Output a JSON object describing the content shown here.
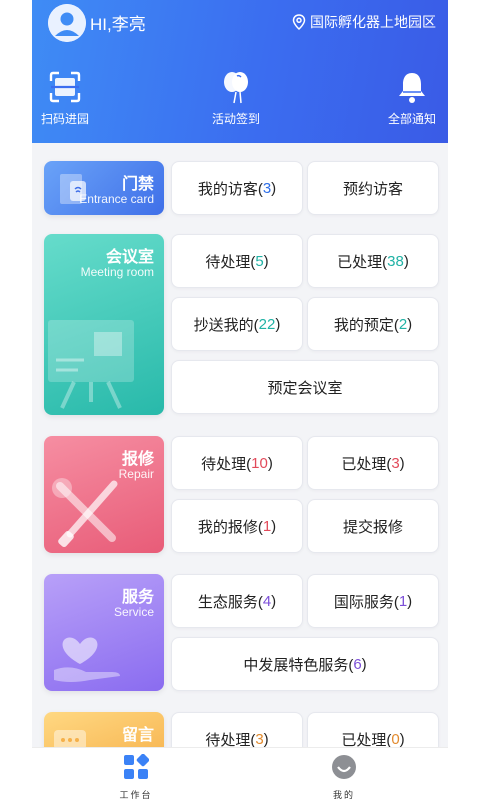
{
  "header": {
    "greeting": "HI,李亮",
    "location": "国际孵化器上地园区",
    "quick_actions": [
      {
        "label": "扫码进园",
        "icon": "scan-icon"
      },
      {
        "label": "活动签到",
        "icon": "balloon-icon"
      },
      {
        "label": "全部通知",
        "icon": "bell-icon"
      }
    ]
  },
  "sections": {
    "access": {
      "title": "门禁",
      "subtitle": "Entrance card",
      "buttons": [
        {
          "label": "我的访客(",
          "count": "3",
          "suffix": ")"
        },
        {
          "label": "预约访客"
        }
      ]
    },
    "meeting": {
      "title": "会议室",
      "subtitle": "Meeting room",
      "buttons": [
        {
          "label": "待处理(",
          "count": "5",
          "suffix": ")"
        },
        {
          "label": "已处理(",
          "count": "38",
          "suffix": ")"
        },
        {
          "label": "抄送我的(",
          "count": "22",
          "suffix": ")"
        },
        {
          "label": "我的预定(",
          "count": "2",
          "suffix": ")"
        },
        {
          "label": "预定会议室"
        }
      ]
    },
    "repair": {
      "title": "报修",
      "subtitle": "Repair",
      "buttons": [
        {
          "label": "待处理(",
          "count": "10",
          "suffix": ")"
        },
        {
          "label": "已处理(",
          "count": "3",
          "suffix": ")"
        },
        {
          "label": "我的报修(",
          "count": "1",
          "suffix": ")"
        },
        {
          "label": "提交报修"
        }
      ]
    },
    "service": {
      "title": "服务",
      "subtitle": "Service",
      "buttons": [
        {
          "label": "生态服务(",
          "count": "4",
          "suffix": ")"
        },
        {
          "label": "国际服务(",
          "count": "1",
          "suffix": ")"
        },
        {
          "label": "中发展特色服务(",
          "count": "6",
          "suffix": ")"
        }
      ]
    },
    "message": {
      "title": "留言",
      "buttons": [
        {
          "label": "待处理(",
          "count": "3",
          "suffix": ")"
        },
        {
          "label": "已处理(",
          "count": "0",
          "suffix": ")"
        }
      ]
    }
  },
  "bottom_nav": [
    {
      "label": "工作台",
      "icon": "grid-icon",
      "active": true
    },
    {
      "label": "我的",
      "icon": "profile-icon",
      "active": false
    }
  ],
  "colors": {
    "header_gradient": [
      "#3f8cf5",
      "#3a5be6"
    ],
    "access": [
      "#6aa3f8",
      "#3f6fe8"
    ],
    "meeting": [
      "#5fd9c8",
      "#2bbfb0"
    ],
    "repair": [
      "#f58aa0",
      "#e9607a"
    ],
    "service": [
      "#b59cf7",
      "#8a6df0"
    ],
    "message": [
      "#ffd27a",
      "#f6b24a"
    ]
  }
}
